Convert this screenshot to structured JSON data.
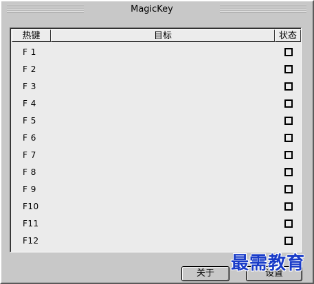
{
  "window": {
    "title": "MagicKey"
  },
  "list": {
    "columns": {
      "key": "热键",
      "target": "目标",
      "status": "状态"
    },
    "rows": [
      {
        "key": "F 1",
        "target": "",
        "checked": false
      },
      {
        "key": "F 2",
        "target": "",
        "checked": false
      },
      {
        "key": "F 3",
        "target": "",
        "checked": false
      },
      {
        "key": "F 4",
        "target": "",
        "checked": false
      },
      {
        "key": "F 5",
        "target": "",
        "checked": false
      },
      {
        "key": "F 6",
        "target": "",
        "checked": false
      },
      {
        "key": "F 7",
        "target": "",
        "checked": false
      },
      {
        "key": "F 8",
        "target": "",
        "checked": false
      },
      {
        "key": "F 9",
        "target": "",
        "checked": false
      },
      {
        "key": "F10",
        "target": "",
        "checked": false
      },
      {
        "key": "F11",
        "target": "",
        "checked": false
      },
      {
        "key": "F12",
        "target": "",
        "checked": false
      }
    ]
  },
  "buttons": {
    "about": "关于",
    "settings": "设置"
  },
  "watermark": "最需教育"
}
